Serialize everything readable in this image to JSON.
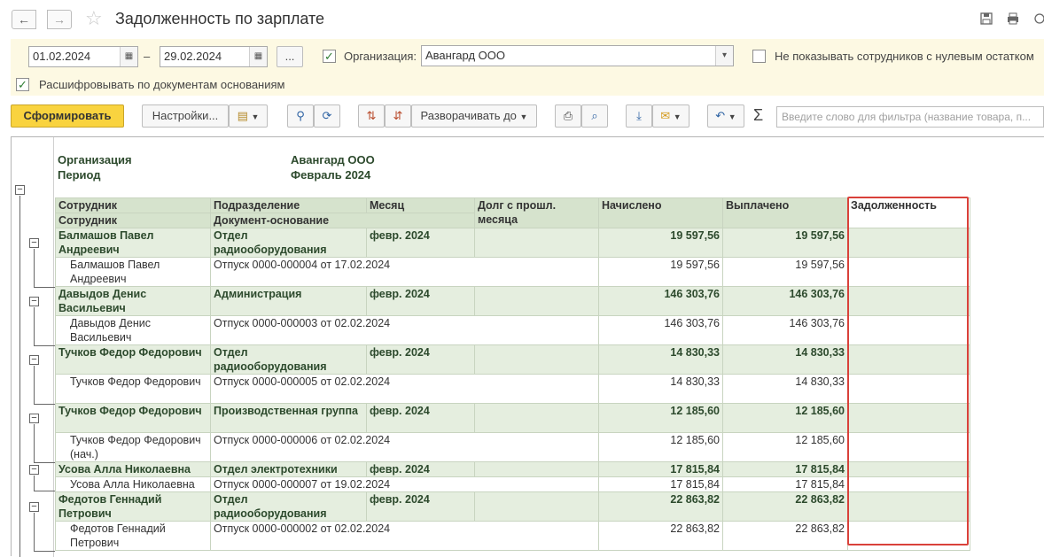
{
  "window": {
    "title": "Задолженность по зарплате",
    "nav_back": "←",
    "nav_forward": "→"
  },
  "filters": {
    "date_from": "01.02.2024",
    "date_separator": "–",
    "date_to": "29.02.2024",
    "period_button": "...",
    "org_label": "Организация:",
    "org_value": "Авангард ООО",
    "org_checked": true,
    "hide_zero_label": "Не показывать сотрудников с нулевым остатком",
    "hide_zero_checked": false,
    "expand_docs_label": "Расшифровывать по документам основаниям",
    "expand_docs_checked": true
  },
  "toolbar": {
    "generate": "Сформировать",
    "settings": "Настройки...",
    "expand_to": "Разворачивать до",
    "sigma": "Σ",
    "filter_placeholder": "Введите слово для фильтра (название товара, п..."
  },
  "report": {
    "org_label": "Организация",
    "org_value": "Авангард ООО",
    "period_label": "Период",
    "period_value": "Февраль 2024",
    "columns": {
      "employee": "Сотрудник",
      "department": "Подразделение",
      "month": "Месяц",
      "prev_debt": "Долг с прошл. месяца",
      "accrued": "Начислено",
      "paid": "Выплачено",
      "debt": "Задолженность",
      "employee2": "Сотрудник",
      "document": "Документ-основание"
    },
    "rows": [
      {
        "type": "group",
        "employee": "Балмашов Павел Андреевич",
        "department": "Отдел радиооборудования",
        "month": "февр. 2024",
        "prev_debt": "",
        "accrued": "19 597,56",
        "paid": "19 597,56",
        "debt": ""
      },
      {
        "type": "detail",
        "employee": "Балмашов Павел Андреевич",
        "document": "Отпуск 0000-000004 от 17.02.2024",
        "accrued": "19 597,56",
        "paid": "19 597,56",
        "debt": ""
      },
      {
        "type": "group",
        "employee": "Давыдов Денис Васильевич",
        "department": "Администрация",
        "month": "февр. 2024",
        "prev_debt": "",
        "accrued": "146 303,76",
        "paid": "146 303,76",
        "debt": ""
      },
      {
        "type": "detail",
        "employee": "Давыдов Денис Васильевич",
        "document": "Отпуск 0000-000003 от 02.02.2024",
        "accrued": "146 303,76",
        "paid": "146 303,76",
        "debt": ""
      },
      {
        "type": "group",
        "employee": "Тучков Федор Федорович",
        "department": "Отдел радиооборудования",
        "month": "февр. 2024",
        "prev_debt": "",
        "accrued": "14 830,33",
        "paid": "14 830,33",
        "debt": ""
      },
      {
        "type": "detail",
        "employee": "Тучков Федор Федорович",
        "document": "Отпуск 0000-000005 от 02.02.2024",
        "accrued": "14 830,33",
        "paid": "14 830,33",
        "debt": ""
      },
      {
        "type": "group",
        "employee": "Тучков Федор Федорович",
        "department": "Производственная группа",
        "month": "февр. 2024",
        "prev_debt": "",
        "accrued": "12 185,60",
        "paid": "12 185,60",
        "debt": ""
      },
      {
        "type": "detail",
        "employee": "Тучков Федор Федорович (нач.)",
        "document": "Отпуск 0000-000006 от 02.02.2024",
        "accrued": "12 185,60",
        "paid": "12 185,60",
        "debt": ""
      },
      {
        "type": "group",
        "employee": "Усова Алла Николаевна",
        "department": "Отдел электротехники",
        "month": "февр. 2024",
        "prev_debt": "",
        "accrued": "17 815,84",
        "paid": "17 815,84",
        "debt": ""
      },
      {
        "type": "detail",
        "employee": "Усова Алла Николаевна",
        "document": "Отпуск 0000-000007 от 19.02.2024",
        "accrued": "17 815,84",
        "paid": "17 815,84",
        "debt": ""
      },
      {
        "type": "group",
        "employee": "Федотов Геннадий Петрович",
        "department": "Отдел радиооборудования",
        "month": "февр. 2024",
        "prev_debt": "",
        "accrued": "22 863,82",
        "paid": "22 863,82",
        "debt": ""
      },
      {
        "type": "detail",
        "employee": "Федотов Геннадий Петрович",
        "document": "Отпуск 0000-000002 от 02.02.2024",
        "accrued": "22 863,82",
        "paid": "22 863,82",
        "debt": ""
      }
    ]
  },
  "icons": [
    "arrow-left-icon",
    "arrow-right-icon",
    "star-icon",
    "save-icon",
    "print-icon",
    "link-icon",
    "more-icon",
    "calendar-icon",
    "dropdown-icon",
    "search-icon",
    "sort-icon",
    "download-icon",
    "mail-icon",
    "undo-icon",
    "collapse-icon"
  ],
  "colors": {
    "accent": "#f9d33f",
    "panel": "#fdf9e3",
    "header": "#d6e3cd",
    "group_row": "#e5eedf",
    "highlight": "#d9413a"
  }
}
